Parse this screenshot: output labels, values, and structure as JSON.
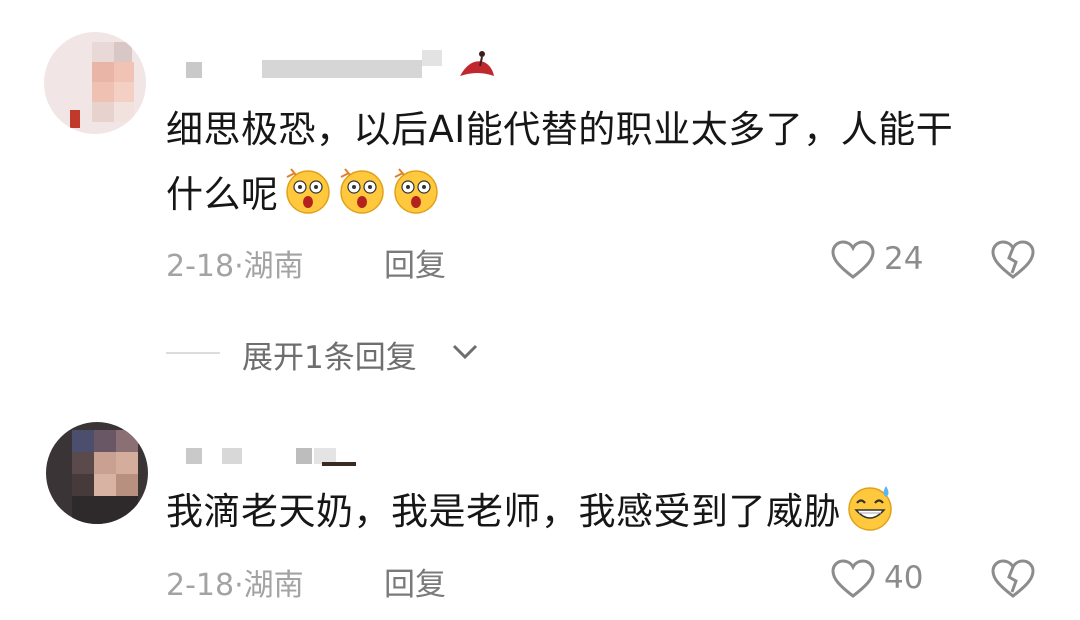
{
  "comments": [
    {
      "text_line1": "细思极恐，以后AI能代替的职业太多了，人能干",
      "text_line2": "什么呢",
      "emojis": [
        "shocked-face-icon",
        "shocked-face-icon",
        "shocked-face-icon"
      ],
      "date": "2-18",
      "location": "湖南",
      "reply_label": "回复",
      "likes": "24"
    },
    {
      "text_line1": "我滴老天奶，我是老师，我感受到了威胁",
      "emojis": [
        "grinning-sweat-face-icon"
      ],
      "date": "2-18",
      "location": "湖南",
      "reply_label": "回复",
      "likes": "40"
    }
  ],
  "expand": {
    "label": "展开1条回复"
  },
  "meta_separator": "·",
  "colors": {
    "text": "#161616",
    "meta": "#a3a3a3",
    "icon_stroke": "#8c8c8c",
    "emoji_yellow": "#ffc83d"
  }
}
